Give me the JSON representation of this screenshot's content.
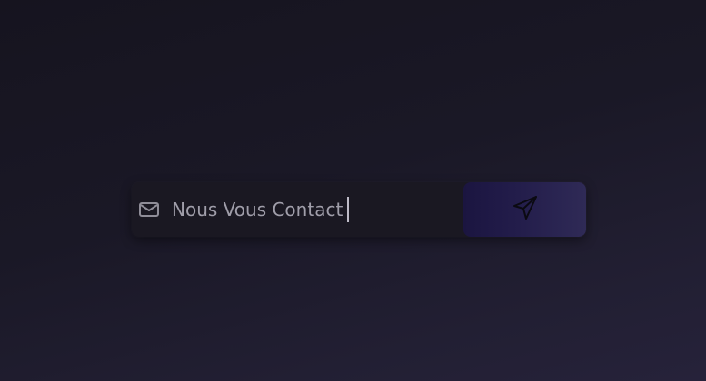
{
  "contact_form": {
    "input": {
      "value": "Nous Vous Contact",
      "icon": "mail-icon"
    },
    "send_button": {
      "icon": "send-icon"
    }
  },
  "colors": {
    "input_text": "#a09eaa",
    "button_accent": "#1b1540"
  }
}
